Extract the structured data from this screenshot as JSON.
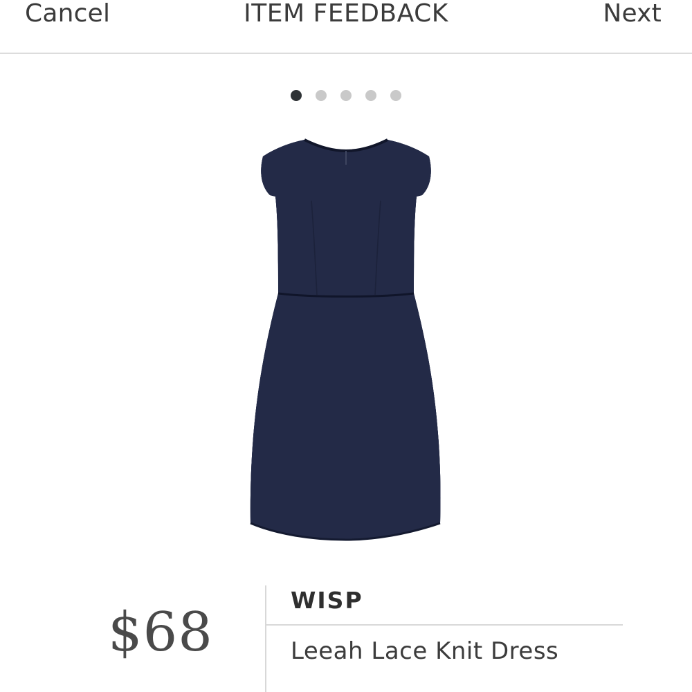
{
  "header": {
    "cancel_label": "Cancel",
    "title": "ITEM FEEDBACK",
    "next_label": "Next"
  },
  "carousel": {
    "dot_count": 5,
    "active_index": 0
  },
  "product": {
    "image_icon": "navy-lace-dress-image",
    "color": "#232a47",
    "price": "$68",
    "brand": "WISP",
    "name": "Leeah Lace Knit Dress"
  }
}
